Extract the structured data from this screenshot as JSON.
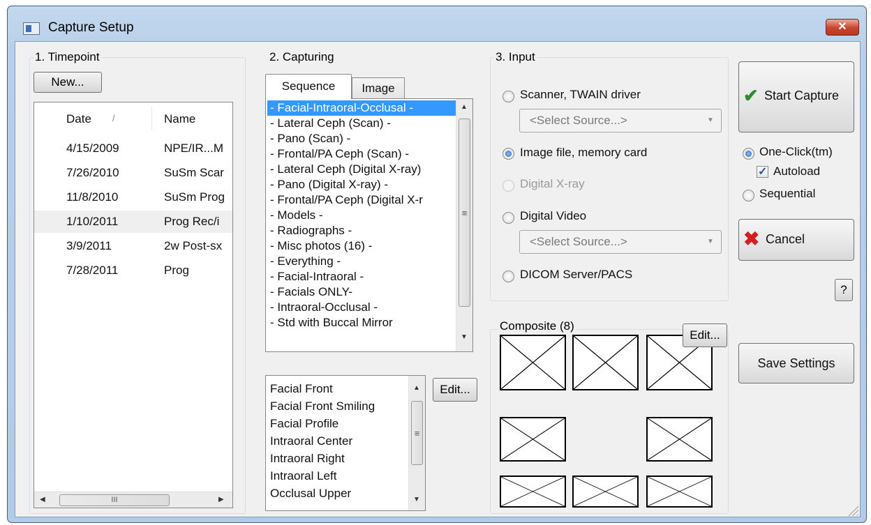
{
  "window": {
    "title": "Capture Setup",
    "close_glyph": "✕"
  },
  "timepoint": {
    "group_label": "1. Timepoint",
    "new_button": "New...",
    "columns": {
      "date": "Date",
      "sort_glyph": "/",
      "name": "Name"
    },
    "rows": [
      {
        "date": "4/15/2009",
        "name": "NPE/IR...M"
      },
      {
        "date": "7/26/2010",
        "name": "SuSm Scar"
      },
      {
        "date": "11/8/2010",
        "name": "SuSm Prog"
      },
      {
        "date": "1/10/2011",
        "name": "Prog Rec/i"
      },
      {
        "date": "3/9/2011",
        "name": "2w Post-sx"
      },
      {
        "date": "7/28/2011",
        "name": "Prog"
      }
    ],
    "hscroll_grip": "III"
  },
  "capturing": {
    "group_label": "2. Capturing",
    "tabs": [
      "Sequence",
      "Image"
    ],
    "sequences": [
      "- Facial-Intraoral-Occlusal -",
      "- Lateral Ceph (Scan) -",
      "- Pano (Scan) -",
      "- Frontal/PA Ceph (Scan) -",
      "- Lateral Ceph (Digital X-ray)",
      "- Pano (Digital X-ray) -",
      "- Frontal/PA Ceph (Digital X-r",
      "- Models -",
      "- Radiographs -",
      "- Misc photos (16) -",
      "- Everything -",
      "- Facial-Intraoral -",
      "- Facials ONLY-",
      "- Intraoral-Occlusal -",
      "- Std with Buccal Mirror"
    ],
    "images": [
      "Facial Front",
      "Facial Front Smiling",
      "Facial Profile",
      "Intraoral Center",
      "Intraoral Right",
      "Intraoral Left",
      "Occlusal Upper"
    ],
    "edit_button": "Edit...",
    "scroll_grip": "≡"
  },
  "input": {
    "group_label": "3. Input",
    "options": {
      "scanner": "Scanner, TWAIN driver",
      "image_file": "Image file, memory card",
      "digital_xray": "Digital X-ray",
      "digital_video": "Digital Video",
      "dicom": "DICOM Server/PACS"
    },
    "select_source_placeholder": "<Select Source...>",
    "selected": "image_file"
  },
  "composite": {
    "label": "Composite (8)",
    "edit_button": "Edit..."
  },
  "actions": {
    "start_capture": "Start Capture",
    "one_click": "One-Click(tm)",
    "autoload": "Autoload",
    "sequential": "Sequential",
    "cancel": "Cancel",
    "help": "?",
    "save_settings": "Save Settings"
  },
  "colors": {
    "selection": "#3399ff",
    "title_bar": "#b9d1ea",
    "close_button": "#c8452d",
    "check_green": "#2e8b2e",
    "cancel_red": "#d21f1f"
  }
}
